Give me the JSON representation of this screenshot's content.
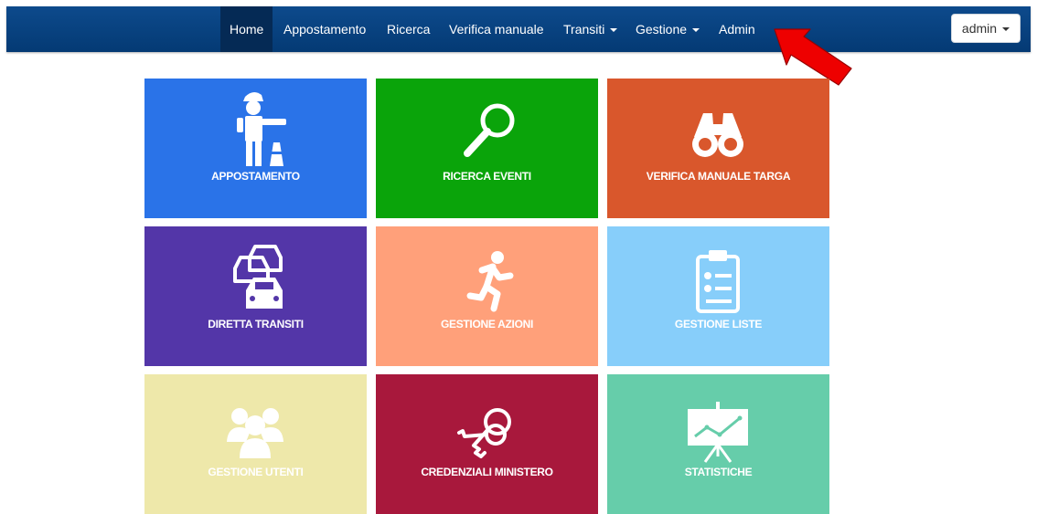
{
  "navbar": {
    "items": [
      {
        "label": "Home",
        "active": true
      },
      {
        "label": "Appostamento"
      },
      {
        "label": "Ricerca"
      },
      {
        "label": "Verifica manuale"
      },
      {
        "label": "Transiti",
        "dropdown": true
      },
      {
        "label": "Gestione",
        "dropdown": true
      },
      {
        "label": "Admin"
      }
    ],
    "user": {
      "label": "admin",
      "dropdown": true
    }
  },
  "annotation": {
    "icon": "red-arrow-icon",
    "color": "#ee0000"
  },
  "tiles": [
    {
      "label": "APPOSTAMENTO",
      "color": "#2a73e8",
      "icon": "traffic-officer-icon"
    },
    {
      "label": "RICERCA EVENTI",
      "color": "#0aa40a",
      "icon": "magnifier-icon"
    },
    {
      "label": "VERIFICA MANUALE TARGA",
      "color": "#d9572c",
      "icon": "binoculars-icon"
    },
    {
      "label": "DIRETTA TRANSITI",
      "color": "#5336a8",
      "icon": "cars-icon"
    },
    {
      "label": "GESTIONE AZIONI",
      "color": "#ffa07a",
      "icon": "running-man-icon"
    },
    {
      "label": "GESTIONE LISTE",
      "color": "#87cefa",
      "icon": "clipboard-list-icon"
    },
    {
      "label": "GESTIONE UTENTI",
      "color": "#eee8aa",
      "icon": "users-group-icon"
    },
    {
      "label": "CREDENZIALI MINISTERO",
      "color": "#a8183c",
      "icon": "keys-icon"
    },
    {
      "label": "STATISTICHE",
      "color": "#66cdaa",
      "icon": "chart-board-icon"
    }
  ]
}
